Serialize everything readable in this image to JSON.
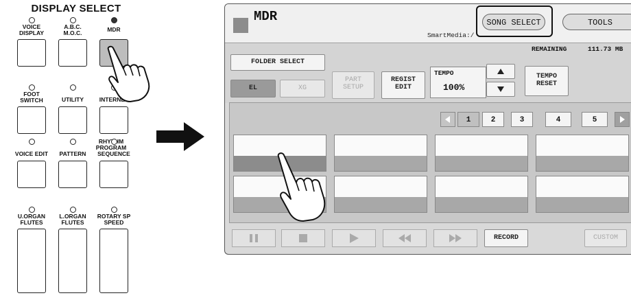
{
  "panel": {
    "title": "DISPLAY SELECT",
    "voice_display": [
      "VOICE",
      "DISPLAY"
    ],
    "abc_moc": [
      "A.B.C.",
      "M.O.C."
    ],
    "mdr": "MDR",
    "foot_switch": [
      "FOOT",
      "SWITCH"
    ],
    "utility": "UTILITY",
    "internet": "INTERNET",
    "voice_edit": "VOICE EDIT",
    "rhythm_program": [
      "RHYTHM",
      "PROGRAM"
    ],
    "pattern": "PATTERN",
    "sequence": "SEQUENCE",
    "upper_organ_flutes": [
      "U.ORGAN",
      "FLUTES"
    ],
    "lower_organ_flutes": [
      "L.ORGAN",
      "FLUTES"
    ],
    "rotary_sp_speed": [
      "ROTARY SP",
      "SPEED"
    ]
  },
  "screen": {
    "title": "MDR",
    "media": "SmartMedia:/",
    "tab_song_select": "SONG SELECT",
    "tab_tools": "TOOLS",
    "folder_select": "FOLDER SELECT",
    "el": "EL",
    "xg": "XG",
    "part_setup": [
      "PART",
      "SETUP"
    ],
    "regist_edit": [
      "REGIST",
      "EDIT"
    ],
    "tempo_label": "TEMPO",
    "tempo_value": "100%",
    "tempo_reset": [
      "TEMPO",
      "RESET"
    ],
    "remaining_label": "REMAINING",
    "remaining_value": "111.73 MB",
    "pages": [
      "1",
      "2",
      "3",
      "4",
      "5"
    ],
    "record": "RECORD",
    "custom": "CUSTOM"
  }
}
